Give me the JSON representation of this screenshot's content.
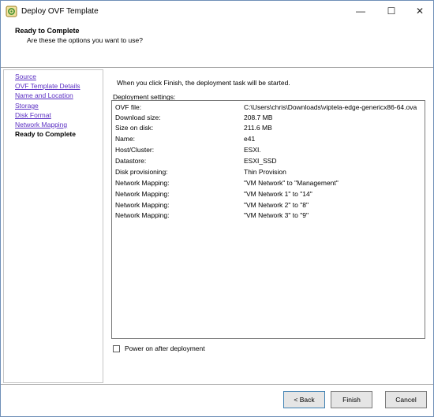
{
  "window": {
    "title": "Deploy OVF Template",
    "controls": {
      "minimize": "—",
      "maximize": "☐",
      "close": "✕"
    },
    "icon": "ovf-template-icon"
  },
  "header": {
    "title": "Ready to Complete",
    "subtitle": "Are these the options you want to use?"
  },
  "nav": {
    "items": [
      {
        "label": "Source",
        "current": false
      },
      {
        "label": "OVF Template Details",
        "current": false
      },
      {
        "label": "Name and Location",
        "current": false
      },
      {
        "label": "Storage",
        "current": false
      },
      {
        "label": "Disk Format",
        "current": false
      },
      {
        "label": "Network Mapping",
        "current": false
      },
      {
        "label": "Ready to Complete",
        "current": true
      }
    ]
  },
  "main": {
    "intro": "When you click Finish, the deployment task will be started.",
    "settings_label": "Deployment settings:",
    "settings": [
      {
        "key": "OVF file:",
        "value": "C:\\Users\\chris\\Downloads\\viptela-edge-genericx86-64.ova"
      },
      {
        "key": "Download size:",
        "value": "208.7 MB"
      },
      {
        "key": "Size on disk:",
        "value": "211.6 MB"
      },
      {
        "key": "Name:",
        "value": "e41"
      },
      {
        "key": "Host/Cluster:",
        "value": "ESXI."
      },
      {
        "key": "Datastore:",
        "value": "ESXI_SSD"
      },
      {
        "key": "Disk provisioning:",
        "value": "Thin Provision"
      },
      {
        "key": "Network Mapping:",
        "value": "\"VM Network\" to \"Management\""
      },
      {
        "key": "Network Mapping:",
        "value": "\"VM Network 1\" to \"14\""
      },
      {
        "key": "Network Mapping:",
        "value": "\"VM Network 2\" to \"8\""
      },
      {
        "key": "Network Mapping:",
        "value": "\"VM Network 3\" to \"9\""
      }
    ],
    "power_on_label": "Power on after deployment",
    "power_on_checked": false
  },
  "footer": {
    "back_label": "< Back",
    "finish_label": "Finish",
    "cancel_label": "Cancel"
  }
}
